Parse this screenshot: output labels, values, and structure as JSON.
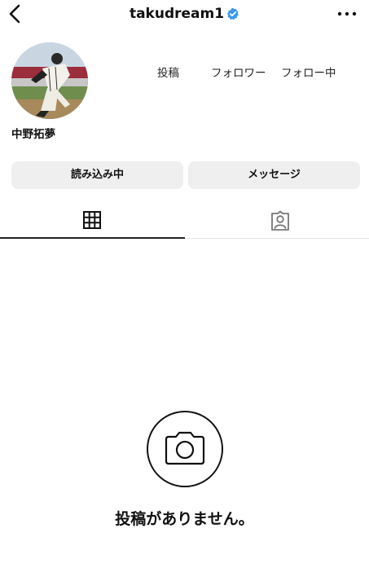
{
  "header": {
    "username": "takudream1",
    "verified_badge_color": "#3897f0",
    "icons": [
      "chevron-left-icon",
      "verified-icon",
      "more-horizontal-icon"
    ]
  },
  "profile": {
    "stats": {
      "posts_label": "投稿",
      "followers_label": "フォロワー",
      "following_label": "フォロー中"
    },
    "display_name": "中野拓夢"
  },
  "actions": {
    "loading_label": "読み込み中",
    "message_label": "メッセージ"
  },
  "tabs": [
    {
      "name": "grid",
      "icon": "grid-icon",
      "active": true
    },
    {
      "name": "tagged",
      "icon": "tagged-person-icon",
      "active": false
    }
  ],
  "empty_state": {
    "icon": "camera-icon",
    "title": "投稿がありません。"
  }
}
